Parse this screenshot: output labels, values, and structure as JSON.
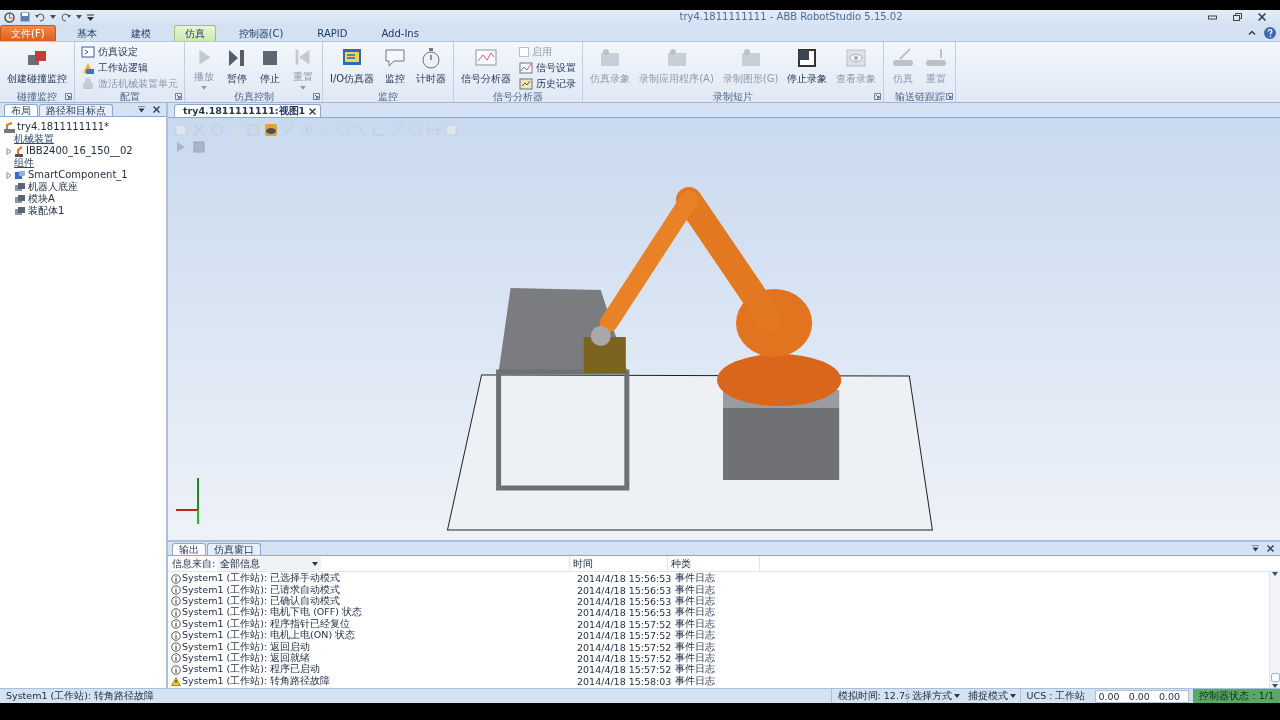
{
  "title_bar": {
    "title": "try4.1811111111 - ABB RobotStudio 5.15.02"
  },
  "ribbon_tabs": [
    {
      "label": "文件(F)",
      "kind": "file",
      "selected": false
    },
    {
      "label": "基本",
      "kind": "tab",
      "selected": false
    },
    {
      "label": "建模",
      "kind": "tab",
      "selected": false
    },
    {
      "label": "仿真",
      "kind": "tab",
      "selected": true
    },
    {
      "label": "控制器(C)",
      "kind": "tab",
      "selected": false
    },
    {
      "label": "RAPID",
      "kind": "tab",
      "selected": false
    },
    {
      "label": "Add-Ins",
      "kind": "tab",
      "selected": false
    }
  ],
  "ribbon_groups": [
    {
      "label": "碰撞监控",
      "launcher": true,
      "buttons": [
        {
          "kind": "big",
          "label": "创建碰撞监控",
          "disabled": false,
          "dropdown": false
        }
      ]
    },
    {
      "label": "配置",
      "launcher": true,
      "buttons": [
        {
          "kind": "small",
          "label": "仿真设定",
          "disabled": false
        },
        {
          "kind": "small",
          "label": "工作站逻辑",
          "disabled": false
        },
        {
          "kind": "small",
          "label": "激活机械装置单元",
          "disabled": true
        }
      ]
    },
    {
      "label": "仿真控制",
      "launcher": true,
      "buttons": [
        {
          "kind": "big",
          "label": "播放",
          "disabled": true,
          "dropdown": true
        },
        {
          "kind": "big",
          "label": "暂停",
          "disabled": false,
          "dropdown": false
        },
        {
          "kind": "big",
          "label": "停止",
          "disabled": false,
          "dropdown": false
        },
        {
          "kind": "big",
          "label": "重置",
          "disabled": true,
          "dropdown": true
        }
      ]
    },
    {
      "label": "监控",
      "launcher": false,
      "buttons": [
        {
          "kind": "big",
          "label": "I/O仿真器",
          "disabled": false,
          "dropdown": false
        },
        {
          "kind": "big",
          "label": "监控",
          "disabled": false,
          "dropdown": false
        },
        {
          "kind": "big",
          "label": "计时器",
          "disabled": false,
          "dropdown": false
        }
      ]
    },
    {
      "label": "信号分析器",
      "launcher": false,
      "buttons": [
        {
          "kind": "big",
          "label": "信号分析器",
          "disabled": false,
          "dropdown": false
        },
        {
          "kind": "checkbox",
          "label": "启用",
          "disabled": true,
          "checked": false
        },
        {
          "kind": "small",
          "label": "信号设置",
          "disabled": false
        },
        {
          "kind": "small",
          "label": "历史记录",
          "disabled": false
        }
      ]
    },
    {
      "label": "录制短片",
      "launcher": true,
      "buttons": [
        {
          "kind": "big",
          "label": "仿真录象",
          "disabled": true,
          "dropdown": false
        },
        {
          "kind": "big",
          "label": "录制应用程序(A)",
          "disabled": true,
          "dropdown": false
        },
        {
          "kind": "big",
          "label": "录制图形(G)",
          "disabled": true,
          "dropdown": false
        },
        {
          "kind": "big",
          "label": "停止录象",
          "disabled": false,
          "dropdown": false
        },
        {
          "kind": "big",
          "label": "查看录象",
          "disabled": true,
          "dropdown": false
        }
      ]
    },
    {
      "label": "输送链跟踪",
      "launcher": true,
      "buttons": [
        {
          "kind": "big",
          "label": "仿真",
          "disabled": true,
          "dropdown": false
        },
        {
          "kind": "big",
          "label": "重置",
          "disabled": true,
          "dropdown": false
        }
      ]
    }
  ],
  "left_panel": {
    "tabs": [
      {
        "label": "布局",
        "selected": true
      },
      {
        "label": "路径和目标点",
        "selected": false
      }
    ],
    "tree": {
      "label": "try4.1811111111*",
      "children": [
        {
          "kind": "header",
          "label": "机械装置"
        },
        {
          "kind": "node",
          "label": "IBB2400_16_150__02",
          "expanded": false
        },
        {
          "kind": "header",
          "label": "组件"
        },
        {
          "kind": "node",
          "label": "SmartComponent_1",
          "expanded": false
        },
        {
          "kind": "leaf",
          "label": "机器人底座"
        },
        {
          "kind": "leaf",
          "label": "模块A"
        },
        {
          "kind": "leaf",
          "label": "装配体1"
        }
      ]
    }
  },
  "document_tab": {
    "label": "try4.1811111111:视图1"
  },
  "output": {
    "tabs": [
      {
        "label": "输出",
        "selected": true
      },
      {
        "label": "仿真窗口",
        "selected": false
      }
    ],
    "filter": {
      "label": "信息来自:",
      "value": "全部信息"
    },
    "columns": [
      "时间",
      "种类"
    ],
    "rows": [
      {
        "kind": "info",
        "message": "System1 (工作站): 已选择手动模式",
        "time": "2014/4/18 15:56:53",
        "type": "事件日志"
      },
      {
        "kind": "info",
        "message": "System1 (工作站): 已请求自动模式",
        "time": "2014/4/18 15:56:53",
        "type": "事件日志"
      },
      {
        "kind": "info",
        "message": "System1 (工作站): 已确认自动模式",
        "time": "2014/4/18 15:56:53",
        "type": "事件日志"
      },
      {
        "kind": "info",
        "message": "System1 (工作站): 电机下电 (OFF) 状态",
        "time": "2014/4/18 15:56:53",
        "type": "事件日志"
      },
      {
        "kind": "info",
        "message": "System1 (工作站): 程序指针已经复位",
        "time": "2014/4/18 15:57:52",
        "type": "事件日志"
      },
      {
        "kind": "info",
        "message": "System1 (工作站): 电机上电(ON) 状态",
        "time": "2014/4/18 15:57:52",
        "type": "事件日志"
      },
      {
        "kind": "info",
        "message": "System1 (工作站): 返回启动",
        "time": "2014/4/18 15:57:52",
        "type": "事件日志"
      },
      {
        "kind": "info",
        "message": "System1 (工作站): 返回就绪",
        "time": "2014/4/18 15:57:52",
        "type": "事件日志"
      },
      {
        "kind": "info",
        "message": "System1 (工作站): 程序已启动",
        "time": "2014/4/18 15:57:52",
        "type": "事件日志"
      },
      {
        "kind": "warning",
        "message": "System1 (工作站): 转角路径故障",
        "time": "2014/4/18 15:58:03",
        "type": "事件日志"
      }
    ]
  },
  "status_bar": {
    "message": "System1 (工作站): 转角路径故障",
    "sim_time": "模拟时间: 12.7s",
    "selection_mode": "选择方式",
    "snap_mode": "捕捉模式",
    "ucs": "UCS : 工作站",
    "coordinates": "0.00   0.00   0.00",
    "controller_status": "控制器状态 : 1/1"
  }
}
